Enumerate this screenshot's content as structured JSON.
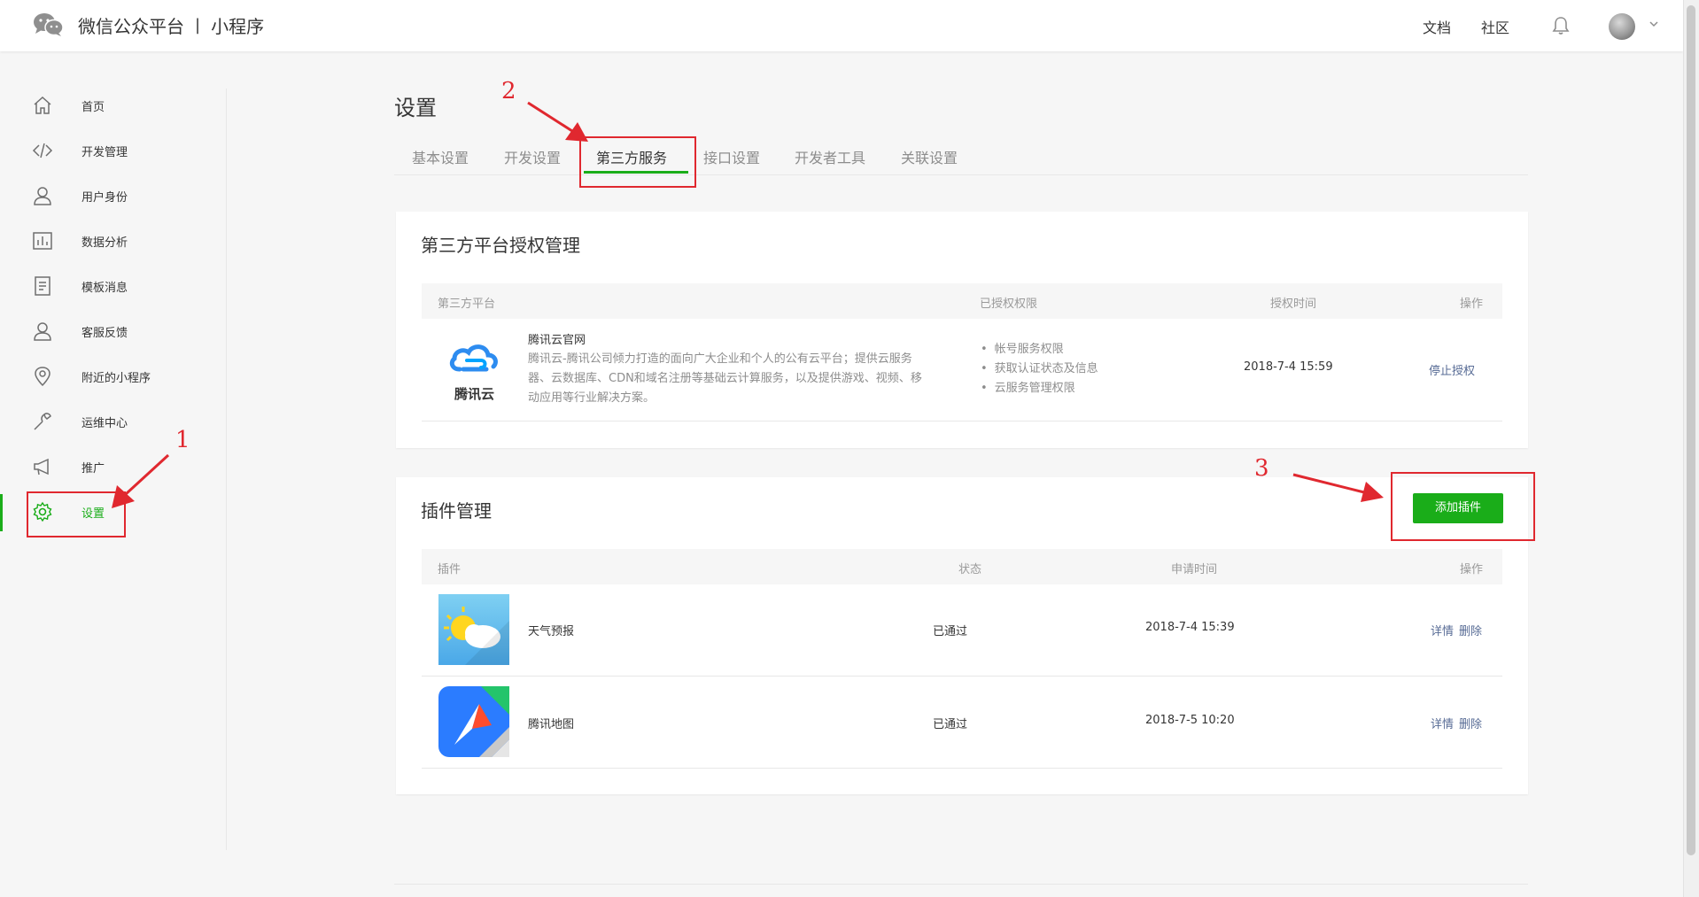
{
  "header": {
    "brand": "微信公众平台",
    "separator": "|",
    "product": "小程序",
    "links": [
      "文档",
      "社区"
    ],
    "icons": [
      "wechat-logo-icon",
      "bell-icon",
      "avatar",
      "chevron-down-icon"
    ]
  },
  "sidebar": {
    "items": [
      {
        "label": "首页",
        "icon": "home-icon"
      },
      {
        "label": "开发管理",
        "icon": "code-icon"
      },
      {
        "label": "用户身份",
        "icon": "user-icon"
      },
      {
        "label": "数据分析",
        "icon": "chart-icon"
      },
      {
        "label": "模板消息",
        "icon": "document-icon"
      },
      {
        "label": "客服反馈",
        "icon": "service-icon"
      },
      {
        "label": "附近的小程序",
        "icon": "location-icon"
      },
      {
        "label": "运维中心",
        "icon": "wrench-icon"
      },
      {
        "label": "推广",
        "icon": "megaphone-icon"
      },
      {
        "label": "设置",
        "icon": "gear-icon",
        "active": true
      }
    ]
  },
  "main": {
    "title": "设置",
    "tabs": [
      "基本设置",
      "开发设置",
      "第三方服务",
      "接口设置",
      "开发者工具",
      "关联设置"
    ],
    "active_tab": "第三方服务"
  },
  "third_party": {
    "title": "第三方平台授权管理",
    "columns": [
      "第三方平台",
      "已授权权限",
      "授权时间",
      "操作"
    ],
    "rows": [
      {
        "logo_text": "腾讯云",
        "name": "腾讯云官网",
        "desc": [
          "腾讯云-腾讯公司倾力打造的面向广大企业和个人的公有云平台；提供云服务",
          "器、云数据库、CDN和域名注册等基础云计算服务，以及提供游戏、视频、移",
          "动应用等行业解决方案。"
        ],
        "permissions": [
          "帐号服务权限",
          "获取认证状态及信息",
          "云服务管理权限"
        ],
        "time": "2018-7-4 15:59",
        "action": "停止授权"
      }
    ]
  },
  "plugins": {
    "title": "插件管理",
    "add_button": "添加插件",
    "columns": [
      "插件",
      "状态",
      "申请时间",
      "操作"
    ],
    "rows": [
      {
        "name": "天气预报",
        "status": "已通过",
        "time": "2018-7-4 15:39",
        "detail": "详情",
        "delete": "删除"
      },
      {
        "name": "腾讯地图",
        "status": "已通过",
        "time": "2018-7-5 10:20",
        "detail": "详情",
        "delete": "删除"
      }
    ]
  },
  "annotations": [
    "1",
    "2",
    "3"
  ],
  "colors": {
    "accent": "#1aad19",
    "link": "#576b95",
    "annotation": "#e0282f"
  }
}
